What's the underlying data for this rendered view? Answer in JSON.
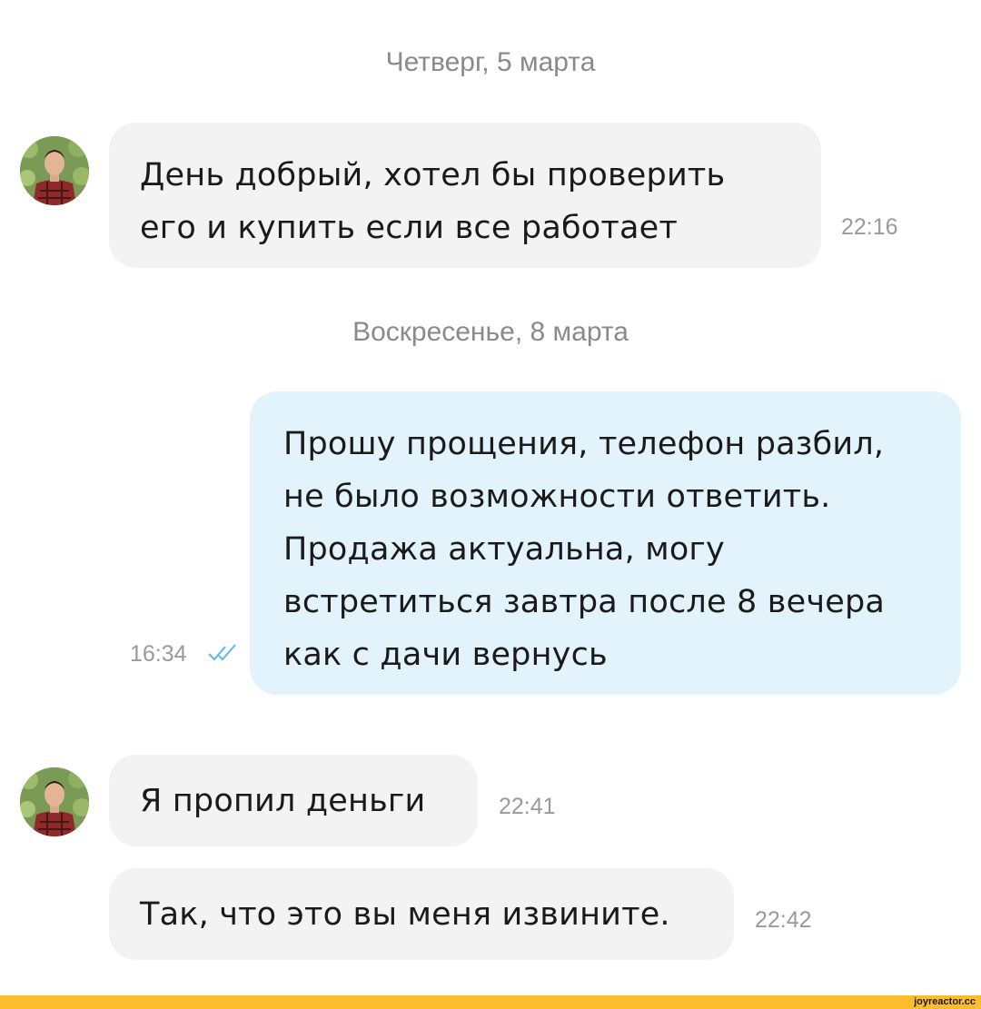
{
  "chat": {
    "date_1": "Четверг, 5 марта",
    "date_2": "Воскресенье, 8 марта",
    "messages": [
      {
        "direction": "incoming",
        "text": "День добрый, хотел бы проверить\nего и купить если все работает",
        "time": "22:16"
      },
      {
        "direction": "outgoing",
        "text": "Прошу прощения, телефон разбил,\nне было возможности ответить.\nПродажа актуальна, могу\nвстретиться завтра после 8 вечера\nкак с дачи вернусь",
        "time": "16:34",
        "status": "read"
      },
      {
        "direction": "incoming",
        "text": "Я пропил деньги",
        "time": "22:41"
      },
      {
        "direction": "incoming",
        "text": "Так, что это вы меня извините.",
        "time": "22:42"
      }
    ]
  },
  "watermark": "joyreactor.cc",
  "colors": {
    "incoming_bubble": "#f3f3f3",
    "outgoing_bubble": "#e3f3fc",
    "read_checks": "#5fb8e6",
    "footer_bar": "#fbbd2b"
  },
  "icons": {
    "avatar": "user-avatar-photo",
    "status": "double-check-icon"
  }
}
